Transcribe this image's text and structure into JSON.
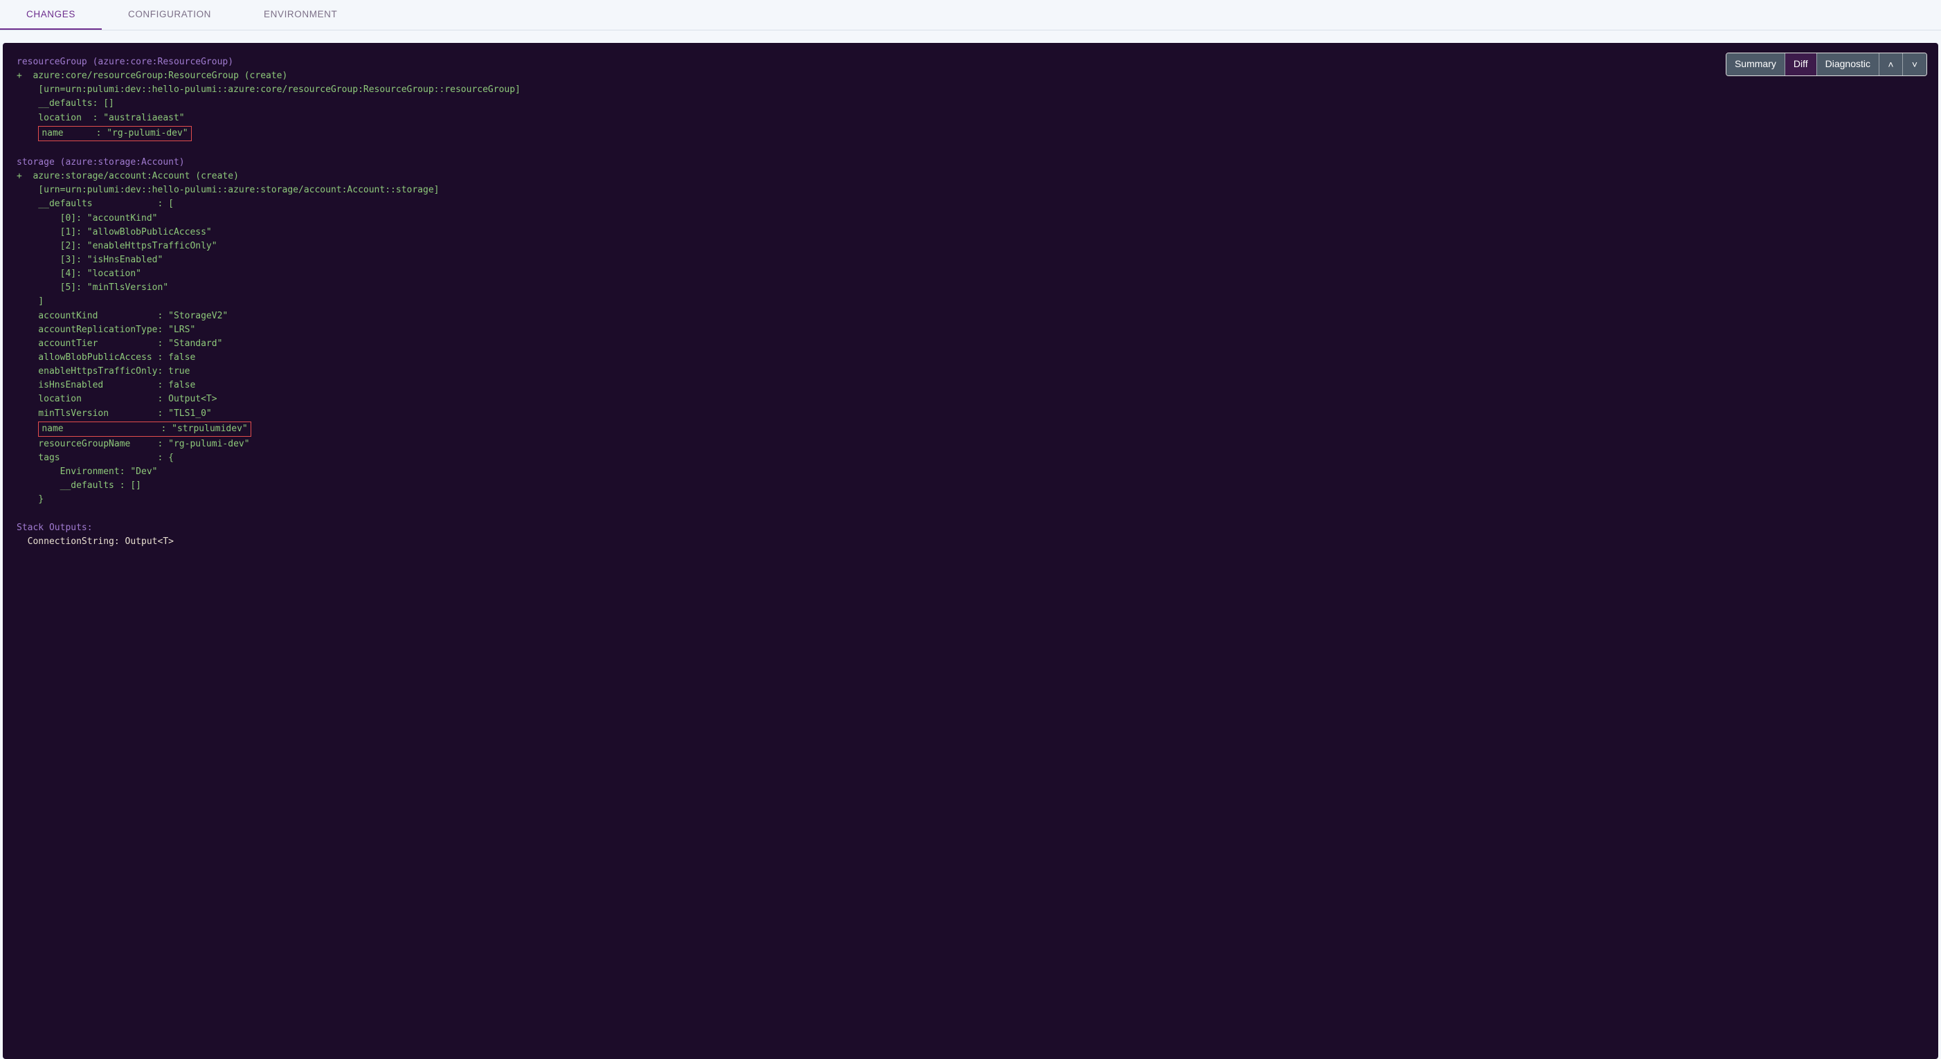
{
  "tabs": {
    "changes": "CHANGES",
    "config": "CONFIGURATION",
    "env": "ENVIRONMENT"
  },
  "buttons": {
    "summary": "Summary",
    "diff": "Diff",
    "diag": "Diagnostic"
  },
  "rg": {
    "header": "resourceGroup (azure:core:ResourceGroup)",
    "createLine": "+  azure:core/resourceGroup:ResourceGroup (create)",
    "urn": "    [urn=urn:pulumi:dev::hello-pulumi::azure:core/resourceGroup:ResourceGroup::resourceGroup]",
    "defaults": "    __defaults: []",
    "location": "    location  : \"australiaeast\"",
    "nameKey": "name      : ",
    "nameVal": "\"rg-pulumi-dev\""
  },
  "st": {
    "header": "storage (azure:storage:Account)",
    "createLine": "+  azure:storage/account:Account (create)",
    "urn": "    [urn=urn:pulumi:dev::hello-pulumi::azure:storage/account:Account::storage]",
    "defOpen": "    __defaults            : [",
    "d0": "        [0]: \"accountKind\"",
    "d1": "        [1]: \"allowBlobPublicAccess\"",
    "d2": "        [2]: \"enableHttpsTrafficOnly\"",
    "d3": "        [3]: \"isHnsEnabled\"",
    "d4": "        [4]: \"location\"",
    "d5": "        [5]: \"minTlsVersion\"",
    "defClose": "    ]",
    "ak": "    accountKind           : \"StorageV2\"",
    "art": "    accountReplicationType: \"LRS\"",
    "at": "    accountTier           : \"Standard\"",
    "abpa": "    allowBlobPublicAccess : false",
    "ehto": "    enableHttpsTrafficOnly: true",
    "ihe": "    isHnsEnabled          : false",
    "loc": "    location              : Output<T>",
    "mtv": "    minTlsVersion         : \"TLS1_0\"",
    "nameKey": "name                  : ",
    "nameVal": "\"strpulumidev\"",
    "rgn": "    resourceGroupName     : \"rg-pulumi-dev\"",
    "tagsOpen": "    tags                  : {",
    "tagEnv": "        Environment: \"Dev\"",
    "tagDef": "        __defaults : []",
    "tagsClose": "    }"
  },
  "outputs": {
    "header": "Stack Outputs:",
    "cs": "  ConnectionString: Output<T>"
  }
}
